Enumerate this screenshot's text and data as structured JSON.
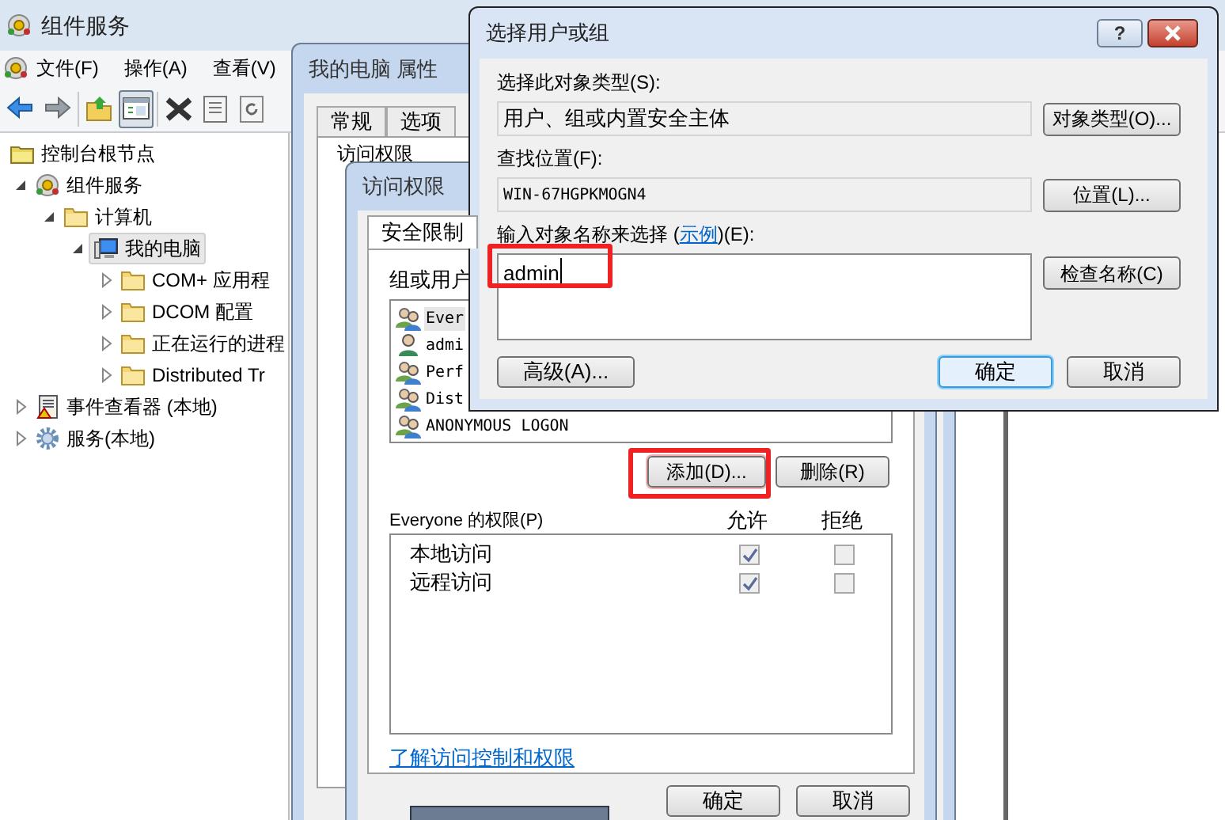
{
  "main_window": {
    "title": "组件服务",
    "menu": [
      "文件(F)",
      "操作(A)",
      "查看(V)"
    ],
    "toolbar": [
      {
        "kind": "back",
        "pressed": false
      },
      {
        "kind": "forward",
        "pressed": false
      },
      {
        "kind": "up",
        "pressed": false
      },
      {
        "kind": "tree",
        "pressed": true
      },
      {
        "kind": "delete",
        "pressed": false
      },
      {
        "kind": "properties",
        "pressed": false
      },
      {
        "kind": "refresh",
        "pressed": false
      }
    ],
    "tree": [
      {
        "label": "控制台根节点",
        "kind": "root",
        "selected": false,
        "children": [
          {
            "label": "组件服务",
            "kind": "services",
            "expanded": true,
            "selected": false,
            "children": [
              {
                "label": "计算机",
                "kind": "folder",
                "expanded": true,
                "selected": false,
                "children": [
                  {
                    "label": "我的电脑",
                    "kind": "computer",
                    "expanded": true,
                    "selected": true,
                    "children": [
                      {
                        "label": "COM+ 应用程",
                        "kind": "folder",
                        "expanded": false,
                        "selected": false
                      },
                      {
                        "label": "DCOM 配置",
                        "kind": "folder",
                        "expanded": false,
                        "selected": false
                      },
                      {
                        "label": "正在运行的进程",
                        "kind": "folder",
                        "expanded": false,
                        "selected": false
                      },
                      {
                        "label": "Distributed Tr",
                        "kind": "folder",
                        "expanded": false,
                        "selected": false
                      }
                    ]
                  }
                ]
              }
            ]
          },
          {
            "label": "事件查看器 (本地)",
            "kind": "event",
            "expanded": false,
            "selected": false
          },
          {
            "label": "服务(本地)",
            "kind": "gear",
            "expanded": false,
            "selected": false
          }
        ]
      }
    ]
  },
  "properties_window": {
    "title": "我的电脑 属性",
    "tabs": [
      {
        "label": "常规",
        "selected": false
      },
      {
        "label": "选项",
        "selected": false
      }
    ],
    "group_label": "访问权限"
  },
  "access_window": {
    "title": "访问权限",
    "tabs": [
      {
        "label": "安全限制",
        "selected": true
      }
    ],
    "users_label": "组或用户",
    "users": [
      {
        "name": "Ever",
        "kind": "group",
        "selected": true
      },
      {
        "name": "admi",
        "kind": "user",
        "selected": false
      },
      {
        "name": "Perf",
        "kind": "group",
        "selected": false
      },
      {
        "name": "Dist",
        "kind": "group",
        "selected": false
      },
      {
        "name": "ANONYMOUS LOGON",
        "kind": "group",
        "selected": false
      }
    ],
    "add_button": {
      "label": "添加(D)...",
      "highlight": true
    },
    "remove_button": {
      "label": "删除(R)",
      "highlight": false
    },
    "permissions_label": "Everyone 的权限(P)",
    "columns": [
      "允许",
      "拒绝"
    ],
    "permissions": [
      {
        "name": "本地访问",
        "allow": true,
        "deny": false,
        "disabled": true
      },
      {
        "name": "远程访问",
        "allow": true,
        "deny": false,
        "disabled": true
      }
    ],
    "link": "了解访问控制和权限",
    "buttons": [
      {
        "label": "确定",
        "default": false
      },
      {
        "label": "取消",
        "default": false
      }
    ]
  },
  "select_dialog": {
    "title": "选择用户或组",
    "help": "?",
    "object_type_label": "选择此对象类型(S):",
    "object_type": "用户、组或内置安全主体",
    "object_type_button": "对象类型(O)...",
    "location_label": "查找位置(F):",
    "location": "WIN-67HGPKMOGN4",
    "location_button": "位置(L)...",
    "name_label": [
      "输入对象名称来选择 (",
      "示例",
      ")(E):"
    ],
    "name_input": {
      "value": "admin",
      "highlight": true
    },
    "check_button": "检查名称(C)",
    "buttons": [
      {
        "label": "高级(A)...",
        "default": false
      },
      {
        "label": "确定",
        "default": true
      },
      {
        "label": "取消",
        "default": false
      }
    ]
  }
}
